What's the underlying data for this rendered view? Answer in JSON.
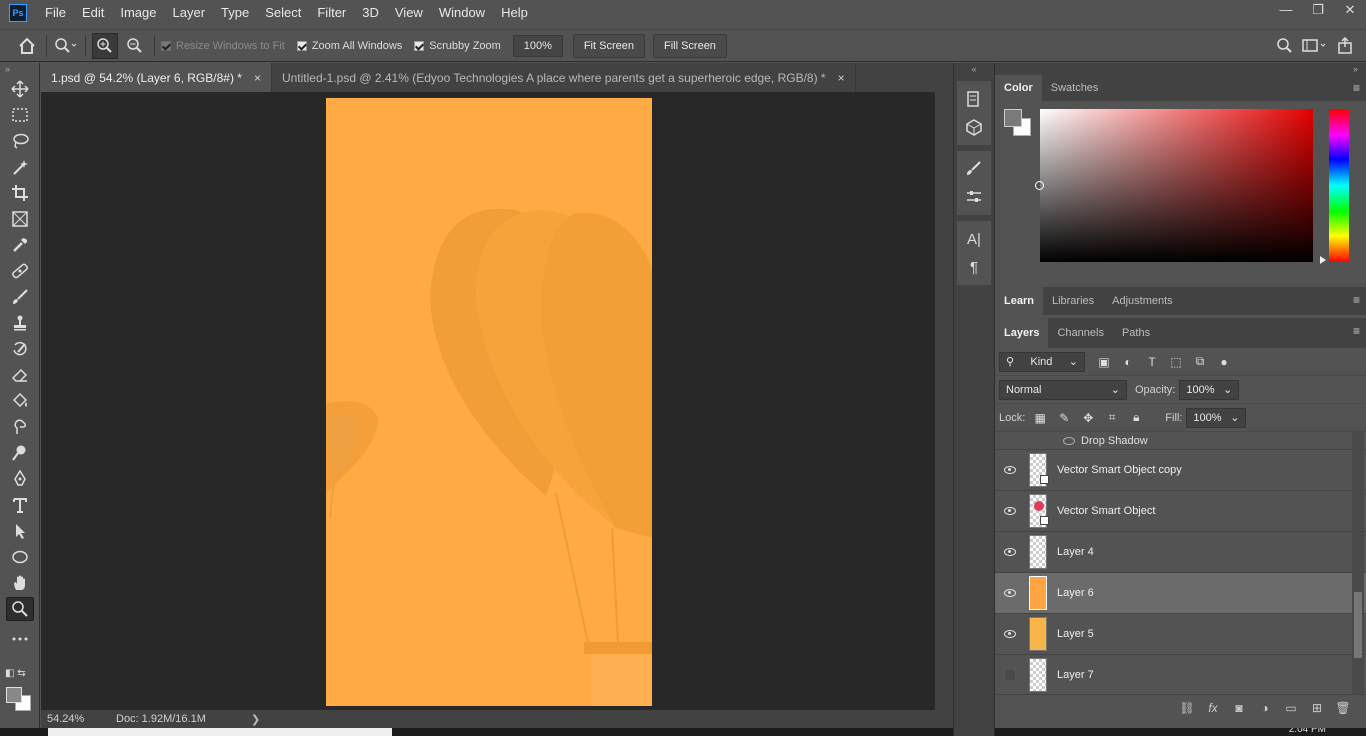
{
  "menu": {
    "logo": "Ps",
    "items": [
      "File",
      "Edit",
      "Image",
      "Layer",
      "Type",
      "Select",
      "Filter",
      "3D",
      "View",
      "Window",
      "Help"
    ]
  },
  "window_controls": [
    "—",
    "❐",
    "✕"
  ],
  "options": {
    "resize_windows": "Resize Windows to Fit",
    "zoom_all": "Zoom All Windows",
    "scrubby": "Scrubby Zoom",
    "zoom_value": "100%",
    "fit_screen": "Fit Screen",
    "fill_screen": "Fill Screen"
  },
  "doc_tabs": [
    {
      "label": "1.psd @ 54.2% (Layer 6, RGB/8#) *",
      "close": "×"
    },
    {
      "label": "Untitled-1.psd @ 2.41% (Edyoo Technologies A place where parents get a superheroic edge, RGB/8) *",
      "close": "×"
    }
  ],
  "status": {
    "zoom": "54.24%",
    "doc": "Doc: 1.92M/16.1M",
    "arrow": "❯",
    "time": "2:04 PM"
  },
  "color_panel": {
    "tabs": [
      "Color",
      "Swatches"
    ],
    "fg_color": "#7a7a7a",
    "bg_color": "#ffffff"
  },
  "learn_panel": {
    "tabs": [
      "Learn",
      "Libraries",
      "Adjustments"
    ]
  },
  "layers_panel": {
    "tabs": [
      "Layers",
      "Channels",
      "Paths"
    ],
    "filter_kind": "Kind",
    "blend_mode": "Normal",
    "opacity_label": "Opacity:",
    "opacity_value": "100%",
    "lock_label": "Lock:",
    "fill_label": "Fill:",
    "fill_value": "100%",
    "effect": "Drop Shadow",
    "layers": [
      {
        "name": "Vector Smart Object copy",
        "visible": true,
        "thumb": "checker-so"
      },
      {
        "name": "Vector Smart Object",
        "visible": true,
        "thumb": "ball-so"
      },
      {
        "name": "Layer 4",
        "visible": true,
        "thumb": "checker"
      },
      {
        "name": "Layer 6",
        "visible": true,
        "thumb": "orange",
        "selected": true
      },
      {
        "name": "Layer 5",
        "visible": true,
        "thumb": "yellow"
      },
      {
        "name": "Layer 7",
        "visible": false,
        "thumb": "checker"
      }
    ]
  },
  "colors": {
    "artboard": "#ffaa45",
    "balloon": "#f09a35",
    "workspace": "#282828",
    "ui": "#535353"
  }
}
